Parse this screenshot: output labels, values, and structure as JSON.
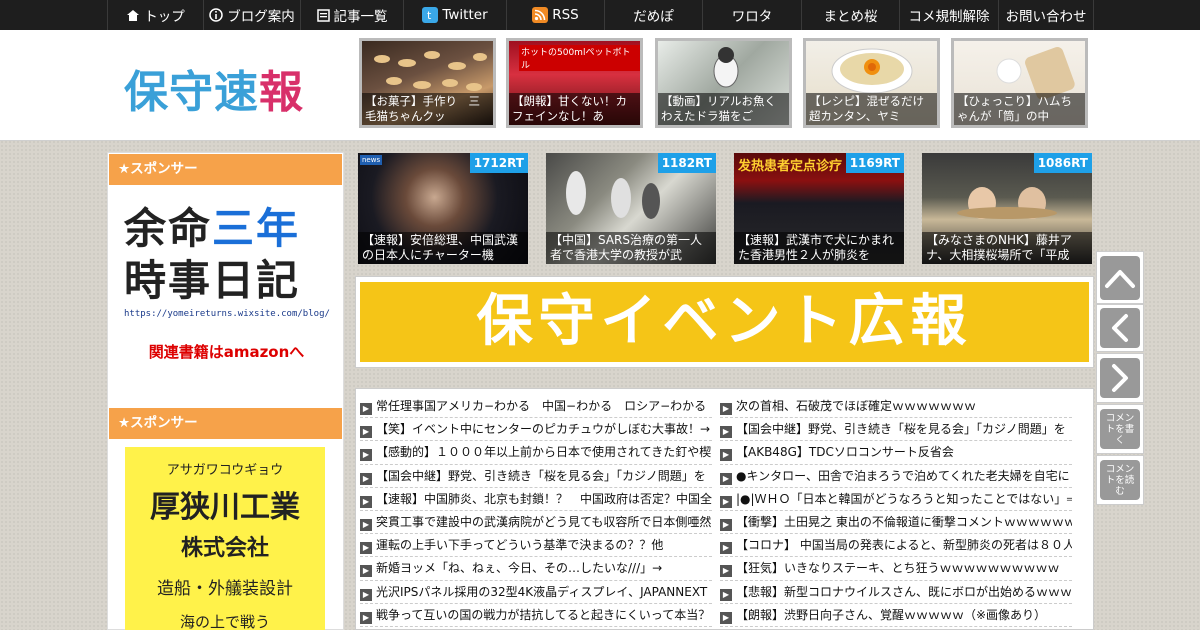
{
  "nav": [
    {
      "label": "トップ",
      "icon": "home-icon",
      "glyph": "⌂"
    },
    {
      "label": "ブログ案内",
      "icon": "info-icon",
      "glyph": "ⓘ"
    },
    {
      "label": "記事一覧",
      "icon": "list-icon",
      "glyph": "▤"
    },
    {
      "label": "Twitter",
      "icon": "twitter-icon",
      "glyph": "t"
    },
    {
      "label": "RSS",
      "icon": "rss-icon",
      "glyph": "◉"
    },
    {
      "label": "だめぽ"
    },
    {
      "label": "ワロタ"
    },
    {
      "label": "まとめ桜"
    },
    {
      "label": "コメ規制解除"
    },
    {
      "label": "お問い合わせ"
    }
  ],
  "header": {
    "logo_chars": [
      "保",
      "守",
      "速",
      "報"
    ],
    "thumbs": [
      {
        "caption": "【お菓子】手作り　三毛猫ちゃんクッ"
      },
      {
        "caption": "【朗報】甘くない！カフェインなし！あ",
        "overlay": "ホットの500mlペットボトル"
      },
      {
        "caption": "【動画】リアルお魚くわえたドラ猫をご"
      },
      {
        "caption": "【レシピ】混ぜるだけ超カンタン、ヤミ"
      },
      {
        "caption": "【ひょっこり】ハムちゃんが「筒」の中"
      }
    ]
  },
  "sidebar": {
    "sponsor_label": "★スポンサー",
    "ad1": {
      "line1a": "余命",
      "line1b": "三年",
      "line2": "時事日記",
      "url": "https://yomeireturns.wixsite.com/blog/",
      "amazon": "関連書籍はamazonへ"
    },
    "ad2": {
      "kana": "アサガワコウギョウ",
      "name": "厚狭川工業",
      "corp": "株式会社",
      "desc": "造船・外艤装設計",
      "more": "海の上で戦う"
    }
  },
  "main": {
    "cards": [
      {
        "rt": "1712RT",
        "caption": "【速報】安倍総理、中国武漢の日本人にチャーター機",
        "badge": "news"
      },
      {
        "rt": "1182RT",
        "caption": "【中国】SARS治療の第一人者で香港大学の教授が武"
      },
      {
        "rt": "1169RT",
        "caption": "【速報】武漢市で犬にかまれた香港男性２人が肺炎を",
        "sign": "发热患者定点诊疗"
      },
      {
        "rt": "1086RT",
        "caption": "【みなさまのNHK】藤井アナ、大相撲桜場所で「平成"
      }
    ],
    "banner": "保守イベント広報",
    "left_links": [
      "常任理事国アメリカ−わかる　中国−わかる　ロシア−わかる",
      "【笑】イベント中にセンターのピカチュウがしぼむ大事故！→",
      "【感動的】１０００年以上前から日本で使用されてきた釘や楔",
      "【国会中継】野党、引き続き「桜を見る会」「カジノ問題」を",
      "【速報】中国肺炎、北京も封鎖！？　中国政府は否定？中国全",
      "突貫工事で建設中の武漢病院がどう見ても収容所で日本側唖然",
      "運転の上手い下手ってどういう基準で決まるの？？他",
      "新婚ヨッメ「ね、ねぇ、今日、その…したいな///」→",
      "光沢IPSパネル採用の32型4K液晶ディスプレイ、JAPANNEXT",
      "戦争って互いの国の戦力が拮抗してると起きにくいって本当？"
    ],
    "right_links": [
      "次の首相、石破茂でほぼ確定ｗｗｗｗｗｗｗ",
      "【国会中継】野党、引き続き「桜を見る会」「カジノ問題」を",
      "【AKB48G】TDCソロコンサート反省会",
      "●キンタロー、田舎で泊まろうで泊めてくれた老夫婦を自宅に",
      "|●|ＷＨＯ「日本と韓国がどうなろうと知ったことではない」⇒",
      "【衝撃】土田晃之 東出の不倫報道に衝撃コメントｗｗｗｗｗｗ",
      "【コロナ】 中国当局の発表によると、新型肺炎の死者は８０人",
      "【狂気】いきなりステーキ、とち狂うｗｗｗｗｗｗｗｗｗｗ",
      "【悲報】新型コロナウイルスさん、既にボロが出始めるｗｗｗ",
      "【朗報】渋野日向子さん、覚醒ｗｗｗｗｗ（※画像あり）"
    ]
  },
  "side_buttons": {
    "comment_write": "コメントを書く",
    "comment_read": "コメントを読む"
  },
  "colors": {
    "accent_orange": "#f6a24a",
    "rt_blue": "#1ea0e8",
    "banner_yellow": "#f5c517",
    "nav_bg": "#1e1e1e"
  }
}
